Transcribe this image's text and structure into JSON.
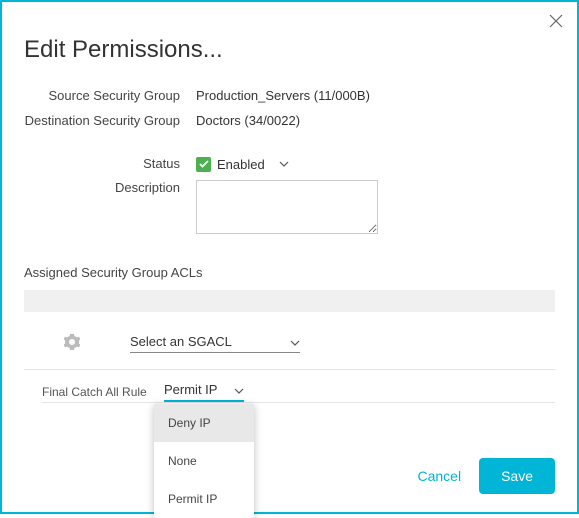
{
  "title": "Edit Permissions...",
  "fields": {
    "source_label": "Source Security Group",
    "source_value": "Production_Servers (11/000B)",
    "dest_label": "Destination Security Group",
    "dest_value": "Doctors (34/0022)",
    "status_label": "Status",
    "status_value": "Enabled",
    "description_label": "Description",
    "description_value": ""
  },
  "acl": {
    "section_label": "Assigned Security Group ACLs",
    "select_placeholder": "Select an SGACL",
    "catch_label": "Final Catch All Rule",
    "catch_value": "Permit IP",
    "options": [
      "Deny IP",
      "None",
      "Permit IP"
    ],
    "highlighted_option_index": 0
  },
  "buttons": {
    "cancel": "Cancel",
    "save": "Save"
  }
}
